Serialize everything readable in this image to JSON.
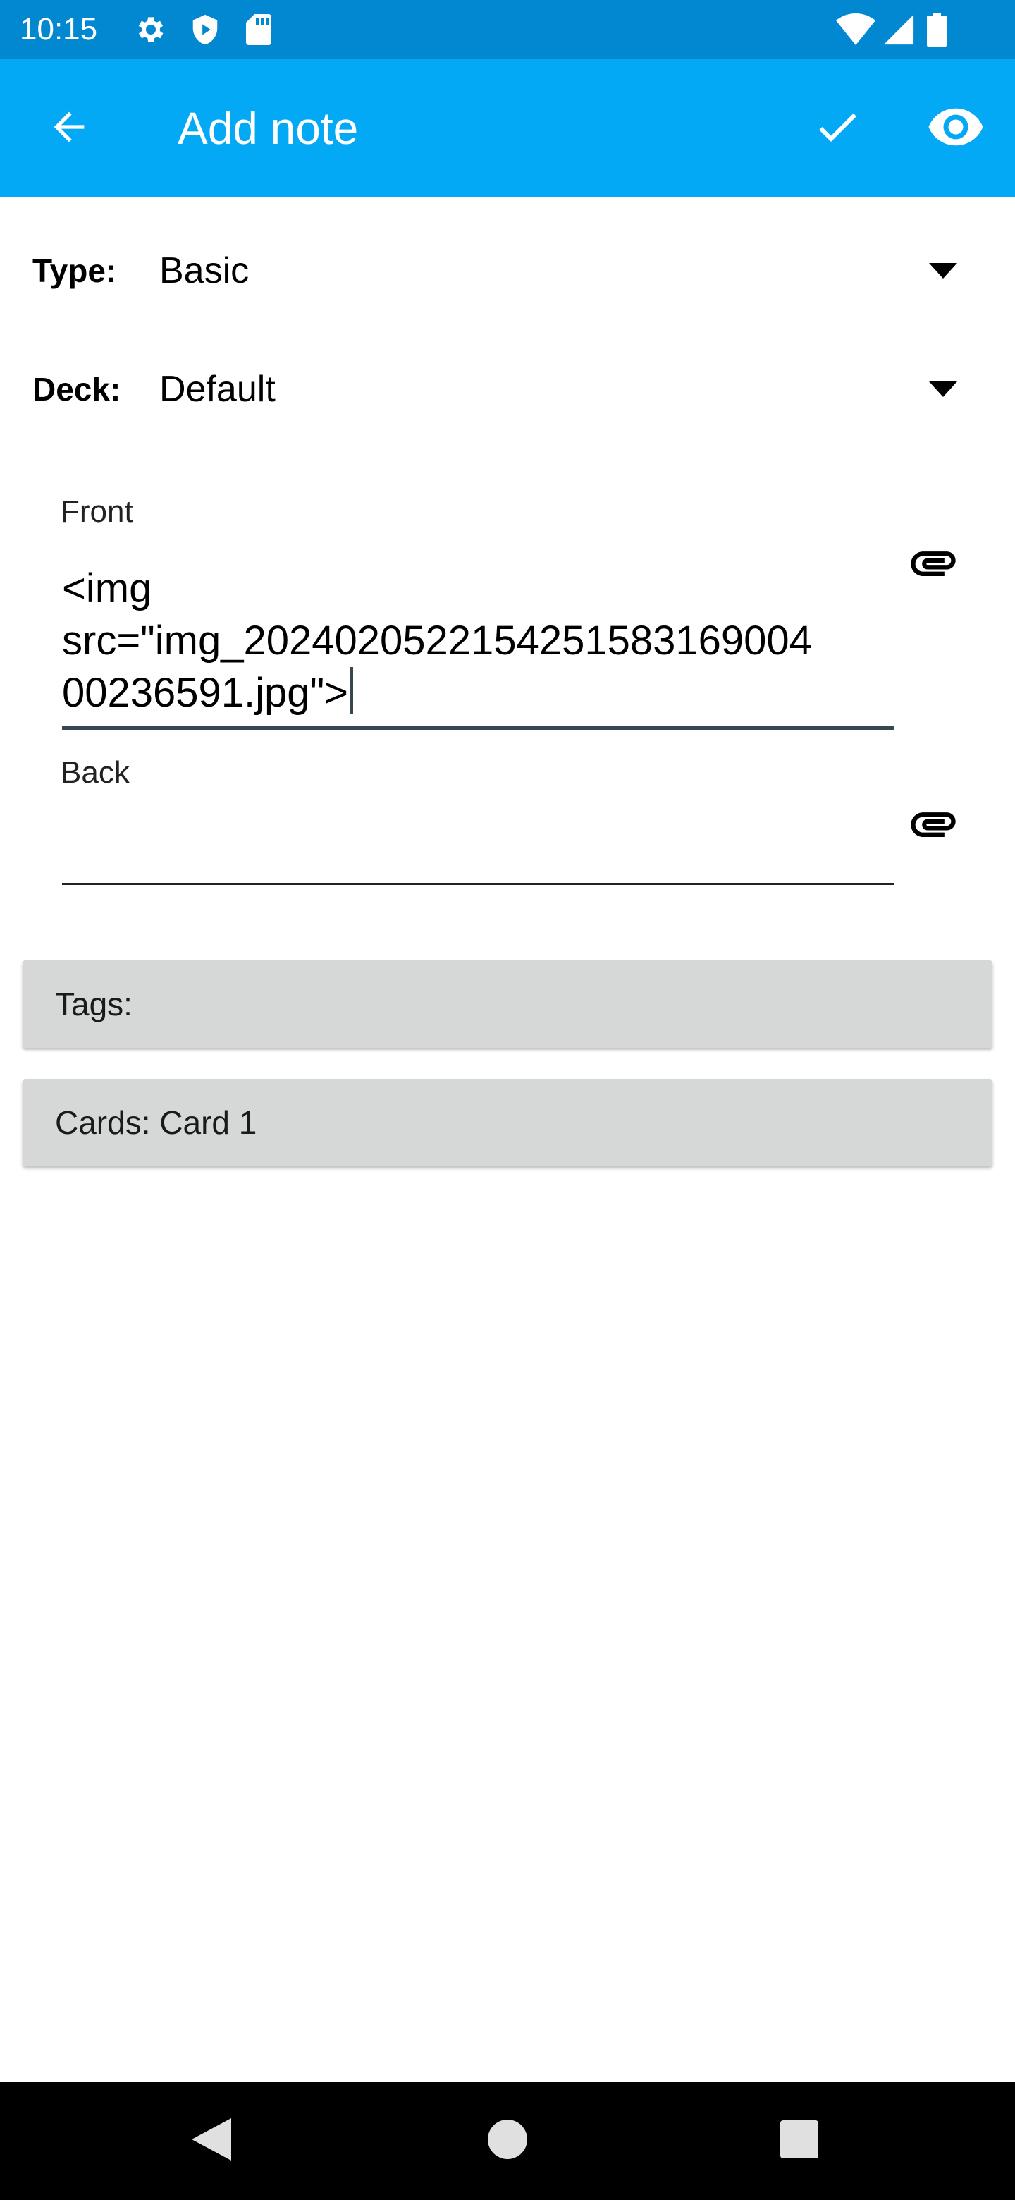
{
  "status_bar": {
    "time": "10:15",
    "icons": [
      "gear-icon",
      "shield-icon",
      "sd-card-icon",
      "wifi-icon",
      "signal-icon",
      "battery-icon"
    ]
  },
  "app_bar": {
    "title": "Add note",
    "back_icon": "arrow-left-icon",
    "save_icon": "check-icon",
    "preview_icon": "eye-icon",
    "background_color": "#03a9f4",
    "status_color": "#0288d1"
  },
  "note_type": {
    "label": "Type:",
    "value": "Basic"
  },
  "deck": {
    "label": "Deck:",
    "value": "Default"
  },
  "fields": [
    {
      "label": "Front",
      "value": "<img src=\"img_20240205221542515831690040 0236591.jpg\">",
      "focused": true
    },
    {
      "label": "Back",
      "value": "",
      "focused": false
    }
  ],
  "front_lines": [
    "<img",
    "src=\"img_2024020522154251583169004",
    "00236591.jpg\">"
  ],
  "tags_label": "Tags:",
  "cards_label": "Cards: Card 1",
  "nav_bar": {
    "icons": [
      "back-triangle-icon",
      "home-circle-icon",
      "recents-square-icon"
    ]
  }
}
